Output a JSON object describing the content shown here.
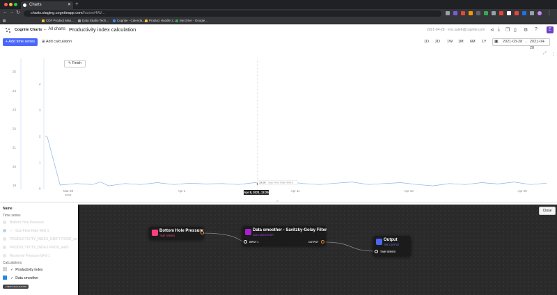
{
  "browser": {
    "tab_title": "Charts",
    "url_domain": "charts.staging.cogniteapp.com",
    "url_path": "/fusion/4tW...",
    "bookmarks": [
      "CDF Product Man...",
      "Data Studio Tech...",
      "Cognite - Calenda...",
      "Product Huddle 2...",
      "My Drive - Google..."
    ]
  },
  "app": {
    "brand": "Cognite Charts",
    "all_charts_label": "All charts",
    "chart_title": "Productivity index calculation",
    "header_meta": "2021-04-28 · eric.saleh@cognite.com",
    "avatar_initial": "E"
  },
  "toolbar": {
    "add_time_series": "+ Add time series",
    "add_calculation": "Add calculation",
    "ranges": [
      "1D",
      "2D",
      "1W",
      "1M",
      "6M",
      "1Y"
    ],
    "date_from": "2021-03-28",
    "date_to": "2021-04-28"
  },
  "chart_data": {
    "type": "line",
    "y_left_ticks": [
      "25",
      "24",
      "23",
      "22",
      "21",
      "20",
      "19"
    ],
    "y_right_ticks": [
      "4",
      "3",
      "2",
      "1",
      "0"
    ],
    "x_ticks": [
      "Mar 28",
      "Apr 4",
      "Apr 11",
      "Apr 18",
      "Apr 25"
    ],
    "x_year": "2021",
    "finish_label": "Finish",
    "hover_value_label": "19.08",
    "hover_series_label": "Gas Flow Rate Well 1",
    "hover_date_label": "Apr 8, 2021, 13:25",
    "series": [
      {
        "name": "Gas Flow Rate Well 1",
        "color": "#84b6e8",
        "y_axis": "left",
        "ylim": [
          18.8,
          25.7
        ],
        "x_day": [
          0,
          0.6,
          1,
          1.4,
          2,
          3,
          3.5,
          4,
          5,
          6,
          7,
          8,
          9,
          10,
          11,
          12,
          13,
          14,
          15,
          16,
          17,
          18,
          19,
          20,
          21,
          22,
          23,
          24,
          25,
          26,
          27,
          28,
          29,
          30,
          31
        ],
        "values": [
          21.6,
          21.55,
          19.02,
          19.05,
          19.1,
          19.05,
          19.18,
          18.98,
          19.1,
          19.05,
          19.15,
          19.05,
          19.12,
          19.08,
          19.1,
          19.05,
          19.15,
          19.05,
          19.2,
          19.1,
          19.05,
          19.12,
          19.18,
          19.05,
          19.1,
          19.15,
          19.05,
          18.98,
          19.1,
          19.05,
          19.15,
          19.08,
          19.18,
          19.05,
          19.12
        ]
      }
    ]
  },
  "sidebar": {
    "name_header": "Name",
    "ts_header": "Time series",
    "time_series": [
      "Bottom Hole Pressure",
      "Gas Flow Rate Well 1",
      "PRODUCTIVITY_INDEX_DRIFT PROD_well 1",
      "PRODUCTIVITY_INDEX PROD_well1",
      "Reservoir Pressure Well 1"
    ],
    "calc_header": "Calculations",
    "calculations": [
      {
        "name": "Productivity index",
        "color": "#d3d3d3"
      },
      {
        "name": "Data smoother",
        "color": "#1e88e5"
      }
    ],
    "add_button": "NEW CALCULATION"
  },
  "editor": {
    "close_label": "Close",
    "nodes": [
      {
        "title": "Bottom Hole Pressure",
        "subtitle": "TIME SERIES",
        "color": "#ff3e82",
        "sub_color": "#ff4f8a"
      },
      {
        "title": "Data smoother - Savitzky-Golay Filter",
        "subtitle": "DATA SMOOTHER",
        "color": "#a61fcc",
        "sub_color": "#c140e8",
        "input_label": "INPUT 1",
        "output_label": "OUTPUT"
      },
      {
        "title": "Output",
        "subtitle": "THE OUTPUT",
        "color": "#4a67fb",
        "sub_color": "#6f86ff",
        "input_label": "TIME SERIES"
      }
    ]
  }
}
